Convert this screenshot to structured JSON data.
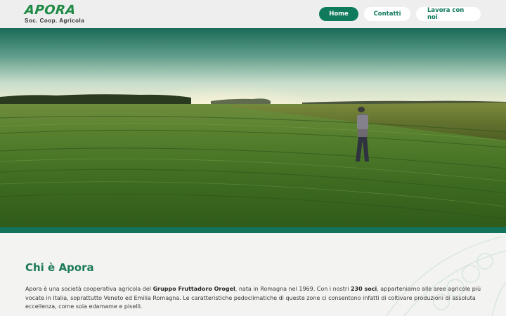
{
  "header": {
    "logo_text": "APORA",
    "logo_subtitle": "Soc. Coop. Agricola",
    "nav": [
      {
        "label": "Home",
        "active": true
      },
      {
        "label": "Contatti",
        "active": false
      },
      {
        "label": "Lavora con noi",
        "active": false
      }
    ]
  },
  "hero": {
    "image": "green field with farmer"
  },
  "about": {
    "title": "Chi è Apora",
    "text_1": "Apora è una società cooperativa agricola del ",
    "text_bold_1": "Gruppo Fruttadoro Orogel",
    "text_2": ", nata in Romagna nel 1969. Con i nostri ",
    "text_bold_2": "230 soci",
    "text_3": ", apparteniamo alle aree agricole più vocate in Italia, soprattutto Veneto ed Emilia Romagna. Le caratteristiche pedoclimatiche di queste zone ci consentono infatti di coltivare produzioni di assoluta eccellenza, come soia edamame e piselli."
  },
  "colors": {
    "brand_green": "#1f8a44",
    "nav_active": "#0f7a5c",
    "strip": "#15735d",
    "title": "#1b7a57"
  }
}
